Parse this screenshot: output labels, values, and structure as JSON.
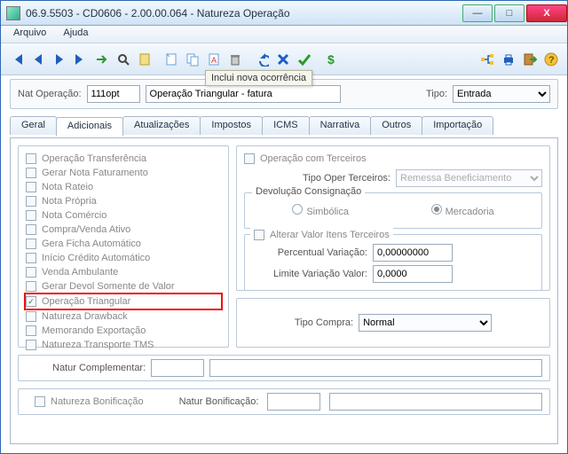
{
  "window": {
    "title": "06.9.5503 - CD0606 - 2.00.00.064 - Natureza Operação"
  },
  "menu": {
    "arquivo": "Arquivo",
    "ajuda": "Ajuda"
  },
  "toolbar": {
    "tooltip": "Inclui nova ocorrência"
  },
  "hdr": {
    "nat_label": "Nat Operação:",
    "nat_code": "111opt",
    "nat_desc": "Operação Triangular - fatura",
    "tipo_label": "Tipo:",
    "tipo_value": "Entrada"
  },
  "tabs": [
    "Geral",
    "Adicionais",
    "Atualizações",
    "Impostos",
    "ICMS",
    "Narrativa",
    "Outros",
    "Importação"
  ],
  "left": [
    "Operação Transferência",
    "Gerar Nota Faturamento",
    "Nota Rateio",
    "Nota Própria",
    "Nota Comércio",
    "Compra/Venda Ativo",
    "Gera Ficha Automático",
    "Início Crédito Automático",
    "Venda Ambulante",
    "Gerar Devol Somente de Valor",
    "Operação Triangular",
    "Natureza Drawback",
    "Memorando Exportação",
    "Natureza Transporte TMS"
  ],
  "right": {
    "op_terceiros": "Operação com Terceiros",
    "tipo_oper_label": "Tipo Oper Terceiros:",
    "tipo_oper_value": "Remessa Beneficiamento",
    "devolucao_title": "Devolução Consignação",
    "simbolica": "Simbólica",
    "mercadoria": "Mercadoria",
    "alterar_label": "Alterar Valor Itens Terceiros",
    "perc_label": "Percentual Variação:",
    "perc_value": "0,00000000",
    "lim_label": "Limite Variação Valor:",
    "lim_value": "0,0000",
    "tipo_compra_label": "Tipo Compra:",
    "tipo_compra_value": "Normal"
  },
  "bottom": {
    "nat_compl_label": "Natur Complementar:",
    "nat_bonif_chk": "Natureza Bonificação",
    "nat_bonif_label": "Natur Bonificação:"
  }
}
